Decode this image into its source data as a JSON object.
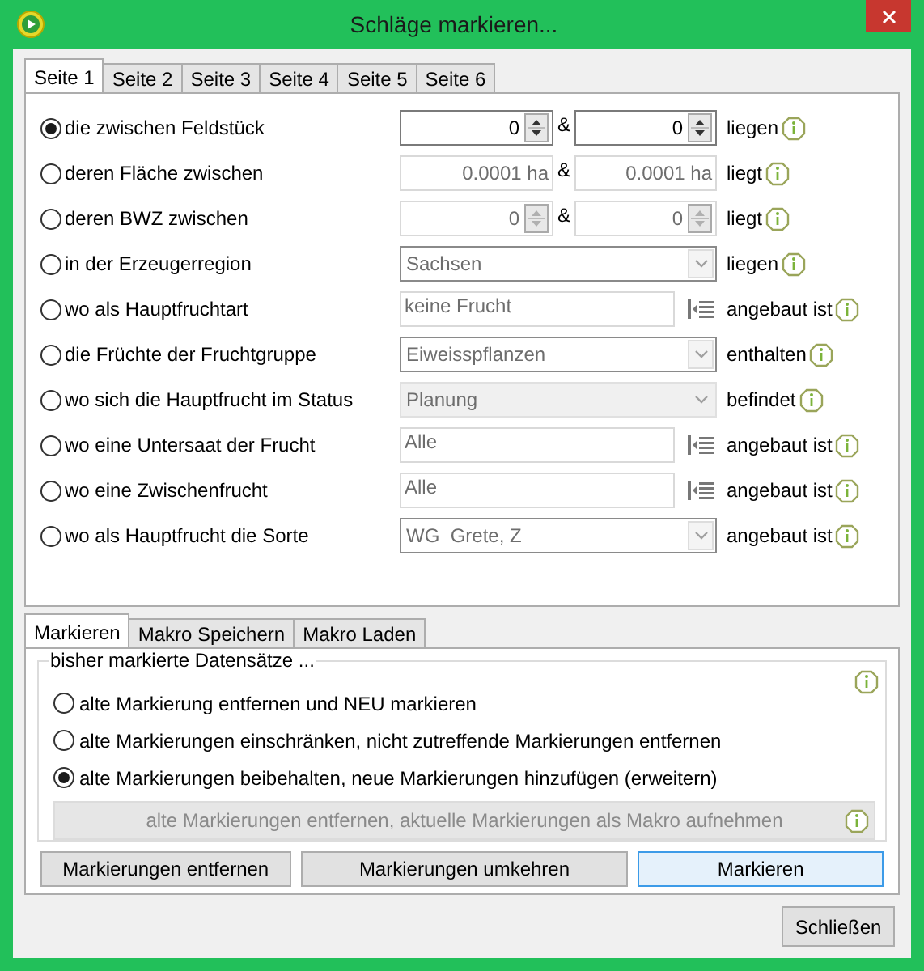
{
  "window": {
    "title": "Schläge markieren..."
  },
  "tabs": [
    {
      "label": "Seite 1",
      "selected": true
    },
    {
      "label": "Seite 2",
      "selected": false
    },
    {
      "label": "Seite 3",
      "selected": false
    },
    {
      "label": "Seite 4",
      "selected": false
    },
    {
      "label": "Seite 5",
      "selected": false
    },
    {
      "label": "Seite 6",
      "selected": false
    }
  ],
  "criteria": [
    {
      "label": "die zwischen Feldstück",
      "selected": true,
      "kind": "spin",
      "disabled": false,
      "from": "0",
      "joiner": "&",
      "to": "0",
      "suffix": "liegen"
    },
    {
      "label": "deren Fläche zwischen",
      "selected": false,
      "kind": "area",
      "disabled": true,
      "from": "0.0001 ha",
      "joiner": "&",
      "to": "0.0001 ha",
      "suffix": "liegt"
    },
    {
      "label": "deren BWZ zwischen",
      "selected": false,
      "kind": "spin",
      "disabled": true,
      "from": "0",
      "joiner": "&",
      "to": "0",
      "suffix": "liegt"
    },
    {
      "label": "in der Erzeugerregion",
      "selected": false,
      "kind": "combo",
      "disabled": false,
      "value": "Sachsen",
      "suffix": "liegen"
    },
    {
      "label": "wo als Hauptfruchtart",
      "selected": false,
      "kind": "list",
      "disabled": true,
      "value": "keine Frucht",
      "suffix": "angebaut ist"
    },
    {
      "label": "die Früchte der Fruchtgruppe",
      "selected": false,
      "kind": "combo",
      "disabled": false,
      "value": "Eiweisspflanzen",
      "suffix": "enthalten"
    },
    {
      "label": "wo sich die Hauptfrucht im Status",
      "selected": false,
      "kind": "combo",
      "disabled": true,
      "value": "Planung",
      "suffix": "befindet"
    },
    {
      "label": "wo eine Untersaat der Frucht",
      "selected": false,
      "kind": "list",
      "disabled": true,
      "value": "Alle",
      "suffix": "angebaut ist"
    },
    {
      "label": "wo eine Zwischenfrucht",
      "selected": false,
      "kind": "list",
      "disabled": true,
      "value": "Alle",
      "suffix": "angebaut ist"
    },
    {
      "label": "wo als Hauptfrucht die Sorte",
      "selected": false,
      "kind": "combo",
      "disabled": false,
      "value": "WG  Grete, Z",
      "suffix": "angebaut ist"
    }
  ],
  "action_tabs": [
    {
      "label": "Markieren",
      "selected": true
    },
    {
      "label": "Makro Speichern",
      "selected": false
    },
    {
      "label": "Makro Laden",
      "selected": false
    }
  ],
  "group": {
    "title": "bisher markierte Datensätze ...",
    "options": [
      {
        "label": "alte Markierung entfernen und NEU markieren",
        "selected": false
      },
      {
        "label": "alte Markierungen einschränken, nicht zutreffende Markierungen entfernen",
        "selected": false
      },
      {
        "label": "alte Markierungen beibehalten, neue Markierungen hinzufügen (erweitern)",
        "selected": true
      }
    ],
    "macro_button": {
      "label": "alte Markierungen entfernen, aktuelle Markierungen als Makro aufnehmen",
      "disabled": true
    }
  },
  "buttons": [
    {
      "label": "Markierungen entfernen",
      "focused": false
    },
    {
      "label": "Markierungen umkehren",
      "focused": false
    },
    {
      "label": "Markieren",
      "focused": true
    }
  ],
  "close_button": {
    "label": "Schließen"
  }
}
